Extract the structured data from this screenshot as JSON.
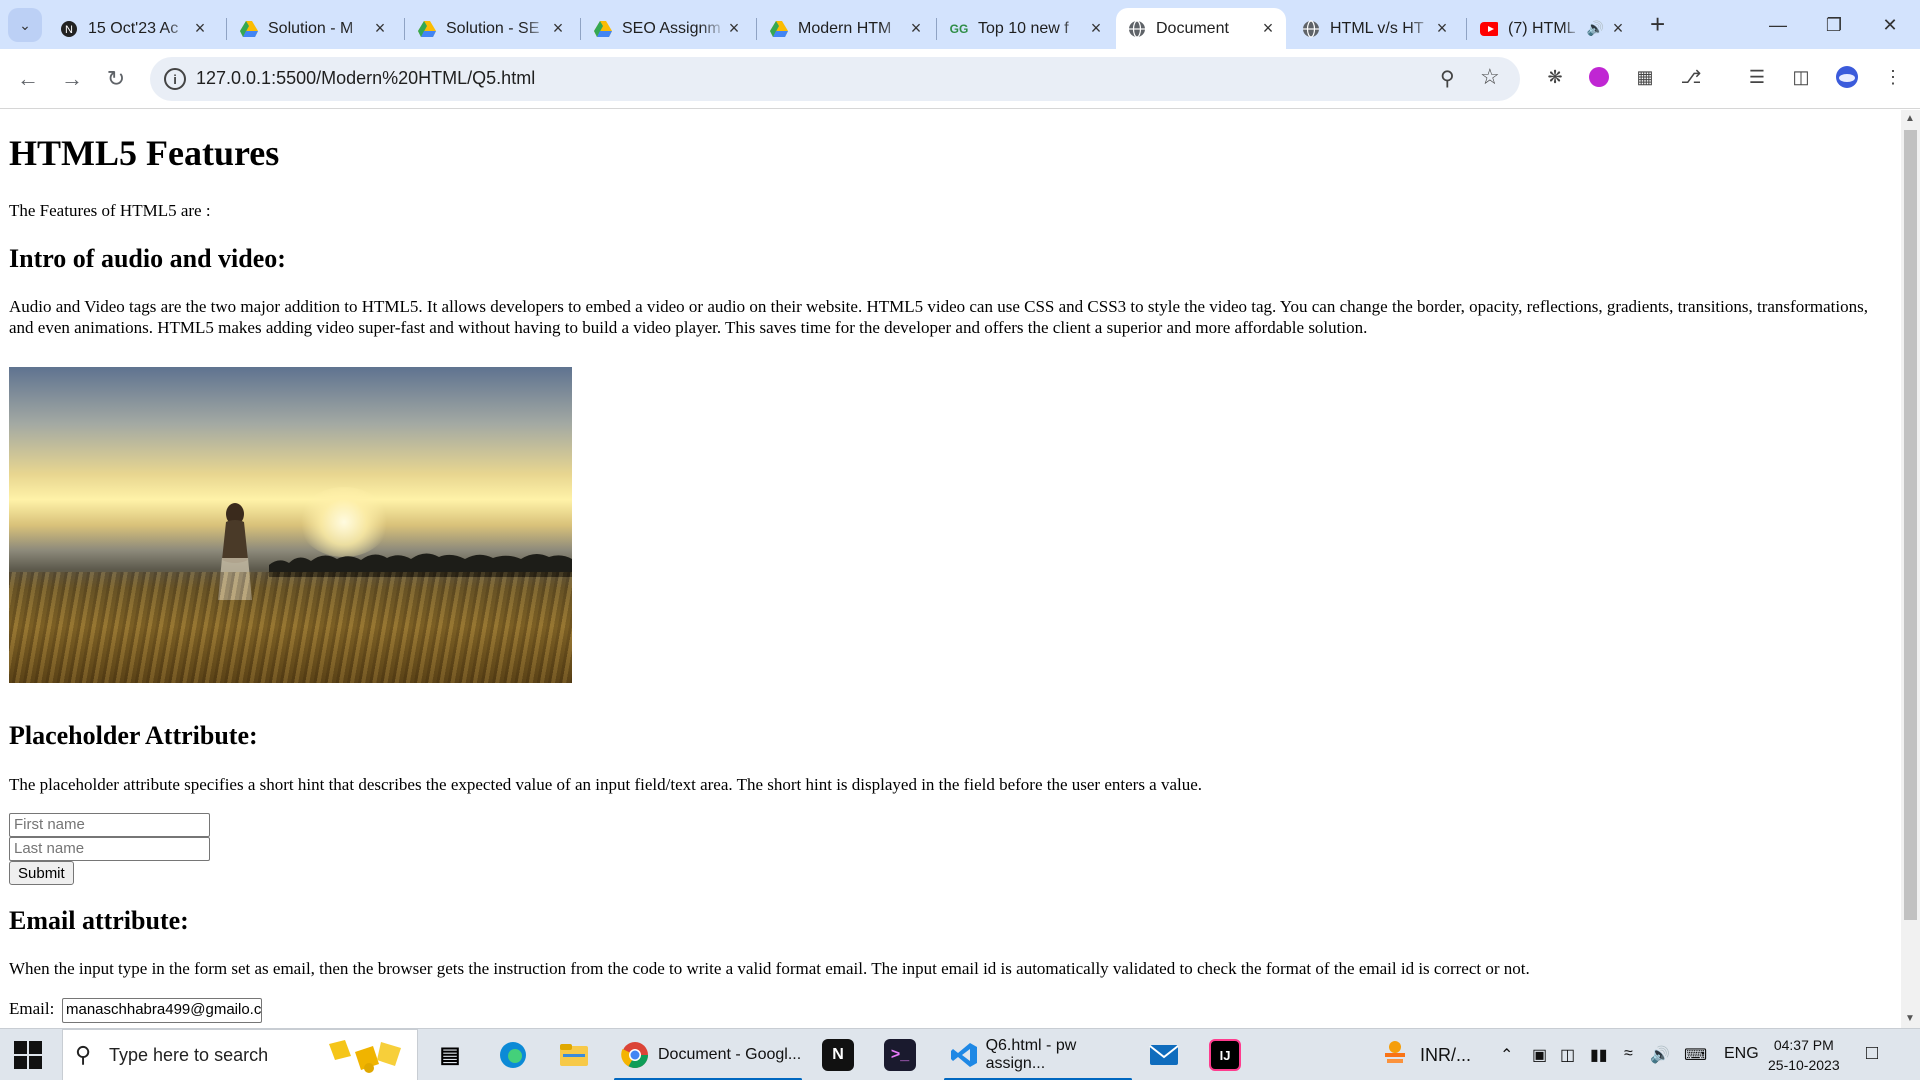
{
  "browser": {
    "tabs": [
      {
        "title": "15 Oct'23 Ac",
        "icon": "notion-icon"
      },
      {
        "title": "Solution - M",
        "icon": "drive-icon"
      },
      {
        "title": "Solution - SE",
        "icon": "drive-icon"
      },
      {
        "title": "SEO Assignm",
        "icon": "drive-icon"
      },
      {
        "title": "Modern HTM",
        "icon": "drive-icon"
      },
      {
        "title": "Top 10 new f",
        "icon": "gfg-icon"
      },
      {
        "title": "Document",
        "icon": "globe-icon",
        "active": true
      },
      {
        "title": "HTML v/s HT",
        "icon": "globe-icon"
      },
      {
        "title": "(7) HTML",
        "icon": "youtube-icon",
        "audio": true
      }
    ],
    "url": "127.0.0.1:5500/Modern%20HTML/Q5.html"
  },
  "page": {
    "title": "HTML5 Features",
    "intro": "The Features of HTML5 are :",
    "audio_video": {
      "heading": "Intro of audio and video:",
      "text": "Audio and Video tags are the two major addition to HTML5. It allows developers to embed a video or audio on their website. HTML5 video can use CSS and CSS3 to style the video tag. You can change the border, opacity, reflections, gradients, transitions, transformations, and even animations. HTML5 makes adding video super-fast and without having to build a video player. This saves time for the developer and offers the client a superior and more affordable solution."
    },
    "placeholder": {
      "heading": "Placeholder Attribute:",
      "text": "The placeholder attribute specifies a short hint that describes the expected value of an input field/text area. The short hint is displayed in the field before the user enters a value.",
      "first_name_placeholder": "First name",
      "last_name_placeholder": "Last name",
      "submit_label": "Submit"
    },
    "email": {
      "heading": "Email attribute:",
      "text": "When the input type in the form set as email, then the browser gets the instruction from the code to write a valid format email. The input email id is automatically validated to check the format of the email id is correct or not.",
      "label": "Email:",
      "value": "manaschhabra499@gmailo.c"
    }
  },
  "taskbar": {
    "search_placeholder": "Type here to search",
    "apps": [
      {
        "label": "Document - Googl...",
        "icon": "chrome-icon"
      },
      {
        "label": "Q6.html - pw assign...",
        "icon": "vscode-icon"
      }
    ],
    "tray": {
      "currency": "INR/...",
      "language": "ENG",
      "time": "04:37 PM",
      "date": "25-10-2023"
    }
  },
  "colors": {
    "tabstrip": "#d3e3fd",
    "omnibox": "#e9eef6",
    "taskbar": "#dfe5ec",
    "accent": "#0067c0"
  }
}
